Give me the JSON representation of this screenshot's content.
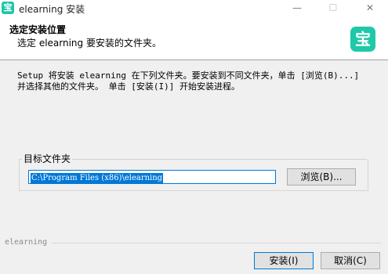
{
  "window": {
    "title": "elearning 安装",
    "icon": "宝",
    "minimize_glyph": "—",
    "maximize_glyph": "☐",
    "close_glyph": "✕"
  },
  "header": {
    "title": "选定安装位置",
    "subtitle": "选定 elearning 要安装的文件夹。",
    "logo_glyph": "宝"
  },
  "content": {
    "description": "Setup 将安装 elearning 在下列文件夹。要安装到不同文件夹，单击 [浏览(B)...]\n并选择其他的文件夹。 单击 [安装(I)] 开始安装进程。",
    "group_label": "目标文件夹",
    "path_value": "C:\\Program Files (x86)\\elearning",
    "browse_label": "浏览(B)..."
  },
  "footer": {
    "brand": "elearning",
    "install_label": "安装(I)",
    "cancel_label": "取消(C)"
  },
  "colors": {
    "accent": "#0078d7",
    "brand": "#1fc8a8"
  }
}
